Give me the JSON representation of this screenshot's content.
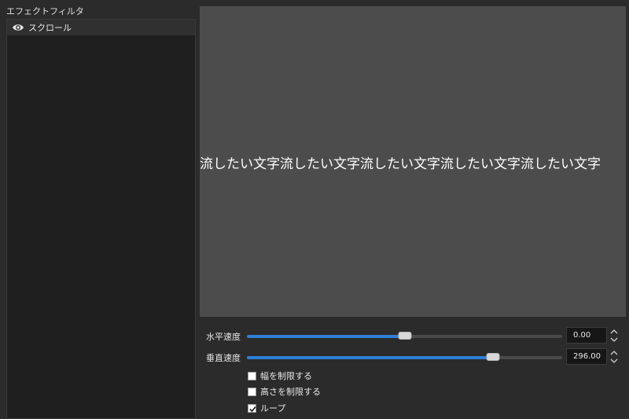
{
  "filters": {
    "label": "エフェクトフィルタ",
    "items": [
      {
        "name": "スクロール",
        "icon": "eye-icon",
        "visible": true
      }
    ]
  },
  "preview": {
    "text": "流したい文字流したい文字流したい文字流したい文字流したい文字"
  },
  "settings": {
    "horizontal_speed": {
      "label": "水平速度",
      "value": "0.00",
      "slider_fraction": 0.5
    },
    "vertical_speed": {
      "label": "垂直速度",
      "value": "296.00",
      "slider_fraction": 0.78
    },
    "limit_width": {
      "label": "幅を制限する",
      "checked": false
    },
    "limit_height": {
      "label": "高さを制限する",
      "checked": false
    },
    "loop": {
      "label": "ループ",
      "checked": true
    }
  },
  "colors": {
    "accent": "#2f7fd6",
    "panel_bg": "#2b2b2b",
    "list_bg": "#1f1f1f",
    "preview_bg": "#4c4c4c"
  }
}
